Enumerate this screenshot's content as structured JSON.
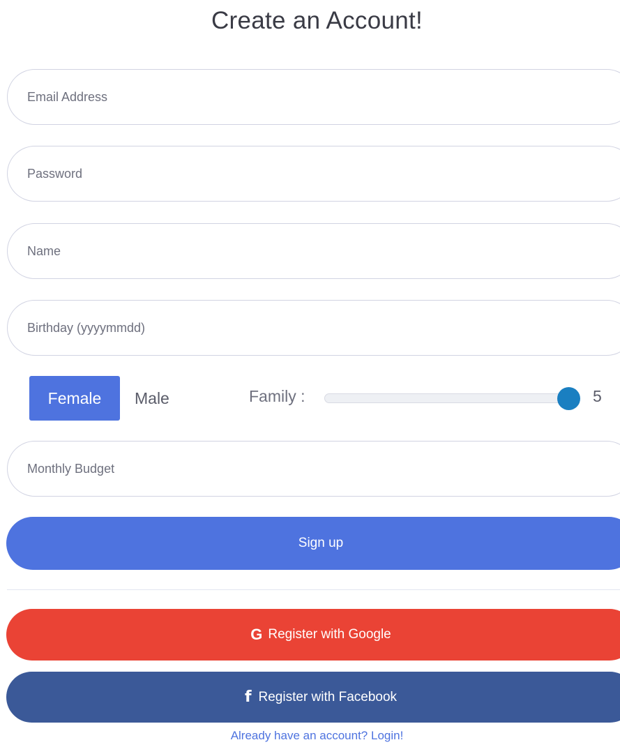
{
  "title": "Create an Account!",
  "fields": {
    "email": {
      "placeholder": "Email Address",
      "value": ""
    },
    "password": {
      "placeholder": "Password",
      "value": ""
    },
    "name": {
      "placeholder": "Name",
      "value": ""
    },
    "birthday": {
      "placeholder": "Birthday (yyyymmdd)",
      "value": ""
    },
    "budget": {
      "placeholder": "Monthly Budget",
      "value": ""
    }
  },
  "gender": {
    "options": [
      "Female",
      "Male"
    ],
    "selected": "Female"
  },
  "family": {
    "label": "Family :",
    "value": "5",
    "fraction": 1.0
  },
  "buttons": {
    "signup": "Sign up",
    "google": "Register with Google",
    "google_icon": "G",
    "facebook": "Register with Facebook",
    "facebook_icon": "f"
  },
  "login_link": "Already have an account? Login!",
  "colors": {
    "primary": "#4e73df",
    "google": "#ea4335",
    "facebook": "#3b5998",
    "slider_thumb": "#1a7fc1"
  }
}
